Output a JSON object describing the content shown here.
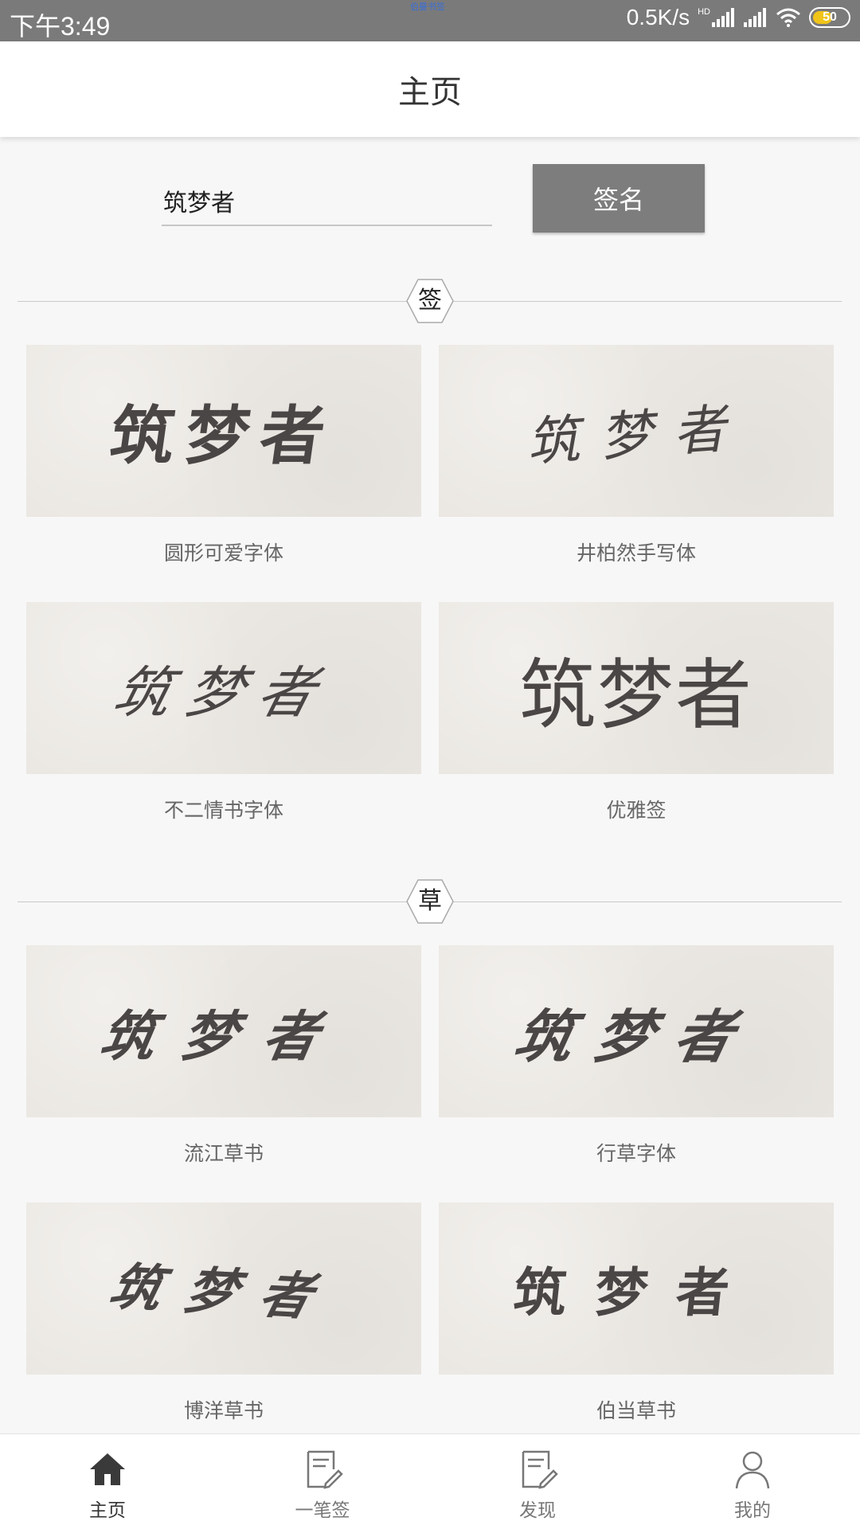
{
  "status_bar": {
    "time": "下午3:49",
    "center_text": "伯曼书签",
    "network_speed": "0.5K/s",
    "hd": "HD",
    "battery": "50",
    "battery_color": "#f0c419"
  },
  "header": {
    "title": "主页"
  },
  "search": {
    "value": "筑梦者",
    "button_label": "签名"
  },
  "sections": [
    {
      "badge": "签",
      "cards": [
        {
          "sample": "筑梦者",
          "label": "圆形可爱字体"
        },
        {
          "sample": "筑梦者",
          "label": "井柏然手写体"
        },
        {
          "sample": "筑梦者",
          "label": "不二情书字体"
        },
        {
          "sample": "筑梦者",
          "label": "优雅签"
        }
      ]
    },
    {
      "badge": "草",
      "cards": [
        {
          "sample": "筑梦者",
          "label": "流江草书"
        },
        {
          "sample": "筑梦者",
          "label": "行草字体"
        },
        {
          "sample": "筑梦者",
          "label": "博洋草书"
        },
        {
          "sample": "筑梦者",
          "label": "伯当草书"
        }
      ]
    }
  ],
  "bottom_nav": [
    {
      "label": "主页",
      "icon": "home-icon",
      "active": true
    },
    {
      "label": "一笔签",
      "icon": "note-pen-icon",
      "active": false
    },
    {
      "label": "发现",
      "icon": "note-pen-icon",
      "active": false
    },
    {
      "label": "我的",
      "icon": "user-icon",
      "active": false
    }
  ]
}
